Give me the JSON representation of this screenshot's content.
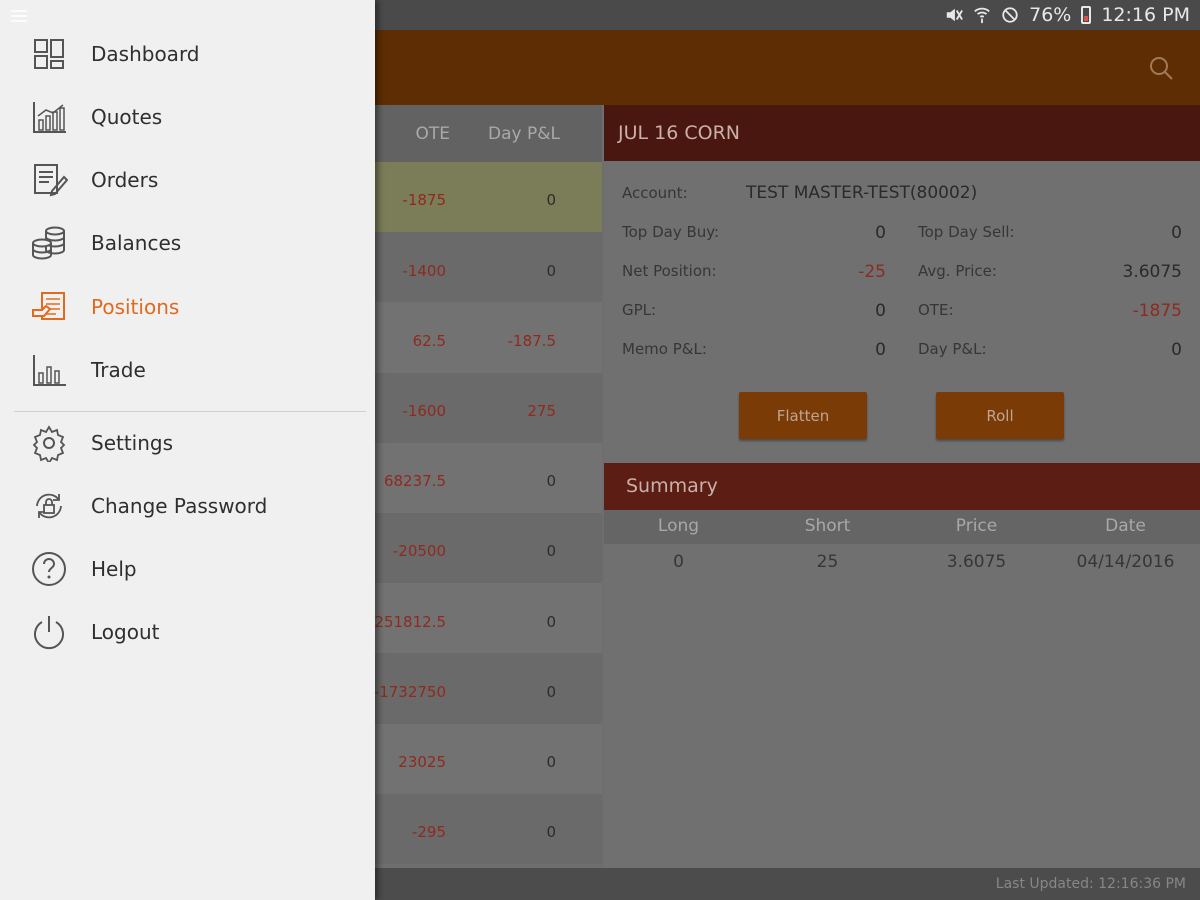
{
  "status_bar": {
    "battery": "76%",
    "time": "12:16 PM"
  },
  "positions_list": {
    "headers": {
      "ote": "OTE",
      "day_pl": "Day P&L"
    },
    "rows": [
      {
        "ote": "-1875",
        "day_pl": "0"
      },
      {
        "ote": "-1400",
        "day_pl": "0"
      },
      {
        "ote": "62.5",
        "day_pl": "-187.5"
      },
      {
        "ote": "-1600",
        "day_pl": "275"
      },
      {
        "ote": "68237.5",
        "day_pl": "0"
      },
      {
        "ote": "-20500",
        "day_pl": "0"
      },
      {
        "ote": "251812.5",
        "day_pl": "0"
      },
      {
        "ote": "-1732750",
        "day_pl": "0"
      },
      {
        "ote": "23025",
        "day_pl": "0"
      },
      {
        "ote": "-295",
        "day_pl": "0"
      }
    ]
  },
  "detail": {
    "title": "JUL 16 CORN",
    "account_label": "Account:",
    "account_value": "TEST MASTER-TEST(80002)",
    "fields": {
      "top_day_buy_label": "Top Day Buy:",
      "top_day_buy": "0",
      "top_day_sell_label": "Top Day Sell:",
      "top_day_sell": "0",
      "net_position_label": "Net Position:",
      "net_position": "-25",
      "avg_price_label": "Avg. Price:",
      "avg_price": "3.6075",
      "gpl_label": "GPL:",
      "gpl": "0",
      "ote_label": "OTE:",
      "ote": "-1875",
      "memo_pl_label": "Memo P&L:",
      "memo_pl": "0",
      "day_pl_label": "Day P&L:",
      "day_pl": "0"
    },
    "flatten_label": "Flatten",
    "roll_label": "Roll"
  },
  "summary": {
    "title": "Summary",
    "columns": [
      "Long",
      "Short",
      "Price",
      "Date"
    ],
    "row": [
      "0",
      "25",
      "3.6075",
      "04/14/2016"
    ]
  },
  "bottom_bar": {
    "last_updated": "Last Updated: 12:16:36 PM"
  },
  "drawer": {
    "items": [
      {
        "label": "Dashboard",
        "icon": "dashboard-icon",
        "active": false
      },
      {
        "label": "Quotes",
        "icon": "quotes-chart-icon",
        "active": false
      },
      {
        "label": "Orders",
        "icon": "orders-document-icon",
        "active": false
      },
      {
        "label": "Balances",
        "icon": "coins-stack-icon",
        "active": false
      },
      {
        "label": "Positions",
        "icon": "positions-cash-icon",
        "active": true
      },
      {
        "label": "Trade",
        "icon": "trade-chart-icon",
        "active": false
      }
    ],
    "secondary_items": [
      {
        "label": "Settings",
        "icon": "gear-icon"
      },
      {
        "label": "Change Password",
        "icon": "lock-refresh-icon"
      },
      {
        "label": "Help",
        "icon": "help-circle-icon"
      },
      {
        "label": "Logout",
        "icon": "power-icon"
      }
    ]
  },
  "colors": {
    "accent": "#e06a1e",
    "header": "#5e2d03",
    "negative": "#8e2a1e"
  }
}
